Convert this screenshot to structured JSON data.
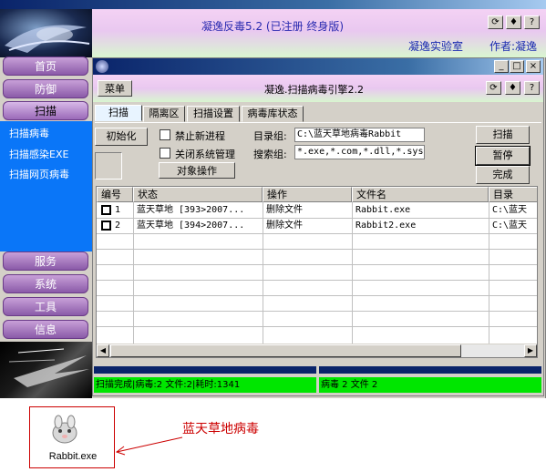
{
  "app": {
    "title": "凝逸反毒5.2 (已注册 终身版)",
    "lab": "凝逸实验室",
    "author": "作者:凝逸",
    "header_buttons": [
      "refresh-icon",
      "pin-icon",
      "help-icon"
    ],
    "window_buttons": [
      "minimize-icon",
      "maximize-icon",
      "close-icon"
    ]
  },
  "nav": {
    "items": [
      "首页",
      "防御",
      "扫描",
      "服务",
      "系统",
      "工具",
      "信息"
    ],
    "active": "扫描",
    "sublinks": [
      "扫描病毒",
      "扫描感染EXE",
      "扫描网页病毒"
    ]
  },
  "inner": {
    "menu_label": "菜单",
    "title": "凝逸.扫描病毒引擎2.2",
    "tabs": [
      "扫描",
      "隔离区",
      "扫描设置",
      "病毒库状态"
    ],
    "init_button": "初始化",
    "checkboxes": [
      "禁止新进程",
      "关闭系统管理"
    ],
    "object_button": "对象操作",
    "dir_group_label": "目录组:",
    "dir_group_value": "C:\\蓝天草地病毒Rabbit",
    "search_group_label": "搜索组:",
    "search_group_value": "*.exe,*.com,*.dll,*.sys",
    "buttons": {
      "scan": "扫描",
      "pause": "暂停",
      "done": "完成"
    }
  },
  "table": {
    "columns": [
      "编号",
      "状态",
      "操作",
      "文件名",
      "目录"
    ],
    "rows": [
      {
        "id": "1",
        "status": "蓝天草地 [393>2007...",
        "action": "删除文件",
        "file": "Rabbit.exe",
        "dir": "C:\\蓝天"
      },
      {
        "id": "2",
        "status": "蓝天草地 [394>2007...",
        "action": "删除文件",
        "file": "Rabbit2.exe",
        "dir": "C:\\蓝天"
      }
    ]
  },
  "status": {
    "left": "扫描完成|病毒:2 文件:2|耗时:1341",
    "right": "病毒 2 文件 2"
  },
  "desktop": {
    "file_label": "Rabbit.exe",
    "annotation": "蓝天草地病毒",
    "annotation_color": "#cc0000"
  }
}
